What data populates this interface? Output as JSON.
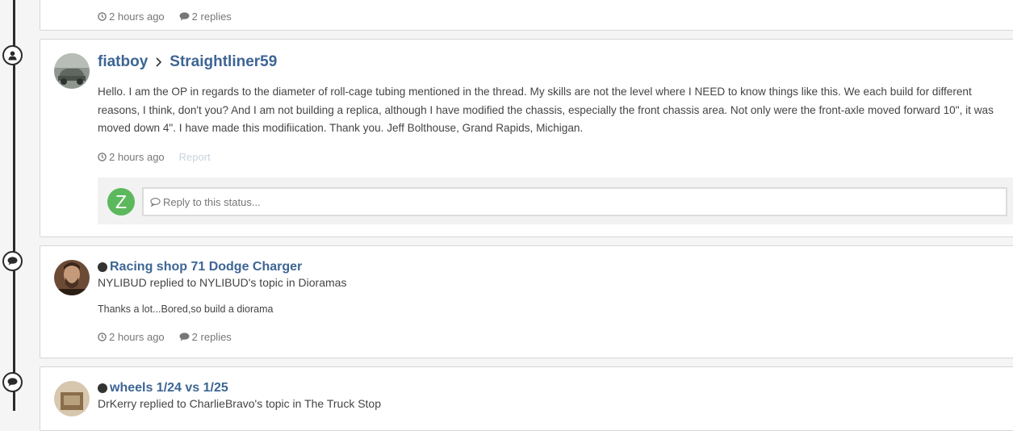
{
  "top_card": {
    "time": "2 hours ago",
    "replies": "2 replies"
  },
  "status_card": {
    "author": "fiatboy",
    "recipient": "Straightliner59",
    "body": "Hello.  I am the OP in regards to the diameter of roll-cage tubing mentioned in the thread.  My skills are not the level where I NEED to know things like this.  We each build for different reasons, I think, don't you?  And I am not building a replica, although I have modified the chassis, especially the front chassis area.  Not only were the front-axle moved forward 10\", it was moved down 4\".  I have made this modifiication.  Thank you.  Jeff Bolthouse, Grand Rapids, Michigan.",
    "time": "2 hours ago",
    "report": "Report",
    "reply_avatar_letter": "Z",
    "reply_placeholder": "Reply to this status..."
  },
  "topic_card_1": {
    "title": "Racing shop 71 Dodge Charger",
    "subtitle": "NYLIBUD replied to NYLIBUD's topic in Dioramas",
    "snippet": "Thanks a lot...Bored,so build a diorama",
    "time": "2 hours ago",
    "replies": "2 replies"
  },
  "topic_card_2": {
    "title": "wheels 1/24 vs 1/25",
    "subtitle": "DrKerry replied to CharlieBravo's topic in The Truck Stop"
  },
  "icons": {
    "timeline_status": "user-icon",
    "timeline_topic": "comment-icon",
    "time": "clock-icon",
    "replies": "comment-icon"
  },
  "colors": {
    "link": "#3d6594",
    "timeline": "#2b2b2b",
    "reply_avatar": "#5cb85c"
  }
}
